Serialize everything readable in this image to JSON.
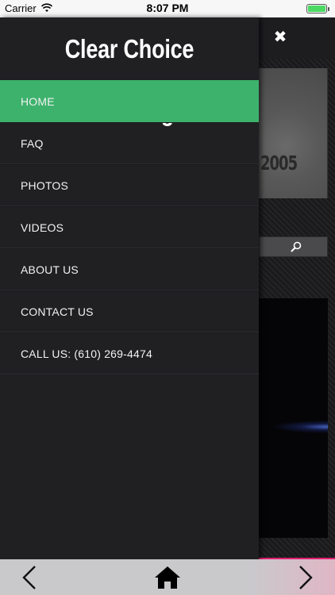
{
  "status_bar": {
    "carrier": "Carrier",
    "time": "8:07 PM",
    "battery_level": 1.0,
    "icons": [
      "wifi-icon",
      "battery-icon"
    ]
  },
  "drawer": {
    "title": "Clear Choice Detailing",
    "items": [
      {
        "label": "HOME",
        "active": true
      },
      {
        "label": "FAQ",
        "active": false
      },
      {
        "label": "PHOTOS",
        "active": false
      },
      {
        "label": "VIDEOS",
        "active": false
      },
      {
        "label": "ABOUT US",
        "active": false
      },
      {
        "label": "CONTACT US",
        "active": false
      },
      {
        "label": "CALL US: (610) 269-4474",
        "active": false
      }
    ]
  },
  "background_page": {
    "close_icon": "close-icon",
    "plate_text": "2005",
    "search_icon": "search-icon"
  },
  "toolbar": {
    "icons": [
      "chevron-left-icon",
      "home-icon",
      "chevron-right-icon"
    ]
  },
  "colors": {
    "accent": "#3db26c",
    "drawer_bg": "#202023",
    "toolbar_bg": "#c9c9cc",
    "battery": "#4cd964"
  }
}
